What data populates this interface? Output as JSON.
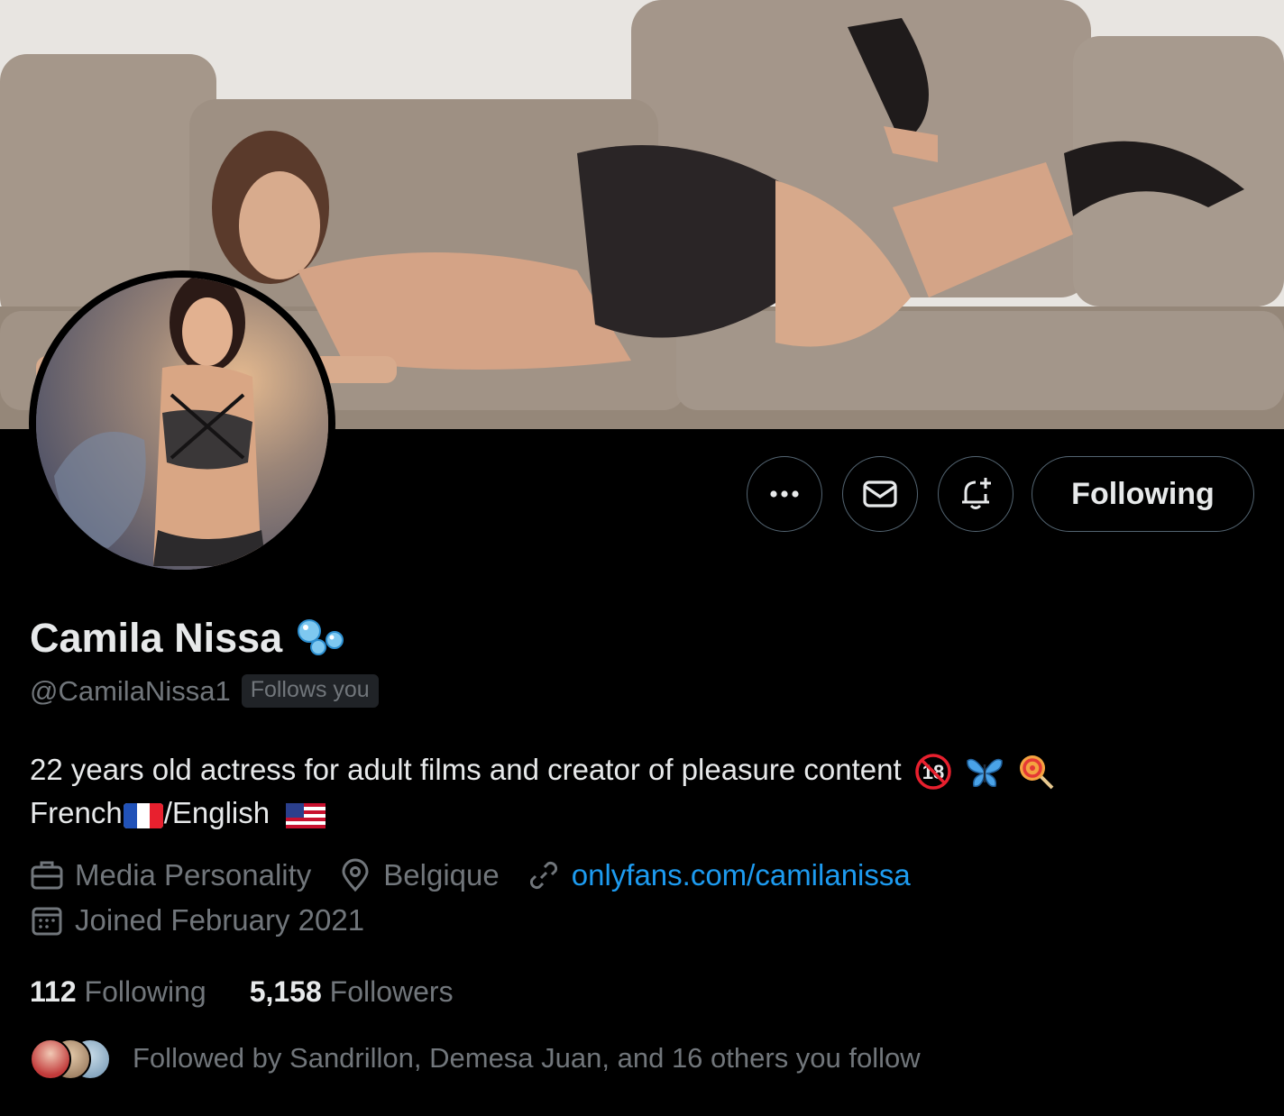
{
  "profile": {
    "display_name": "Camila Nissa",
    "handle": "@CamilaNissa1",
    "follows_you": "Follows you",
    "bio_line1": "22 years old actress for adult films and creator of pleasure content",
    "bio_line2_a": "French",
    "bio_line2_b": "/English",
    "category": "Media Personality",
    "location": "Belgique",
    "website": "onlyfans.com/camilanissa",
    "joined": "Joined February 2021"
  },
  "stats": {
    "following_count": "112",
    "following_label": "Following",
    "followers_count": "5,158",
    "followers_label": "Followers"
  },
  "followed_by": "Followed by Sandrillon, Demesa Juan, and 16 others you follow",
  "actions": {
    "follow_button": "Following",
    "more": "more-icon",
    "message": "mail-icon",
    "notify": "bell-plus-icon"
  },
  "colors": {
    "background": "#000000",
    "text_primary": "#e7e9ea",
    "text_secondary": "#71767b",
    "link": "#1d9bf0",
    "border": "#536471"
  }
}
